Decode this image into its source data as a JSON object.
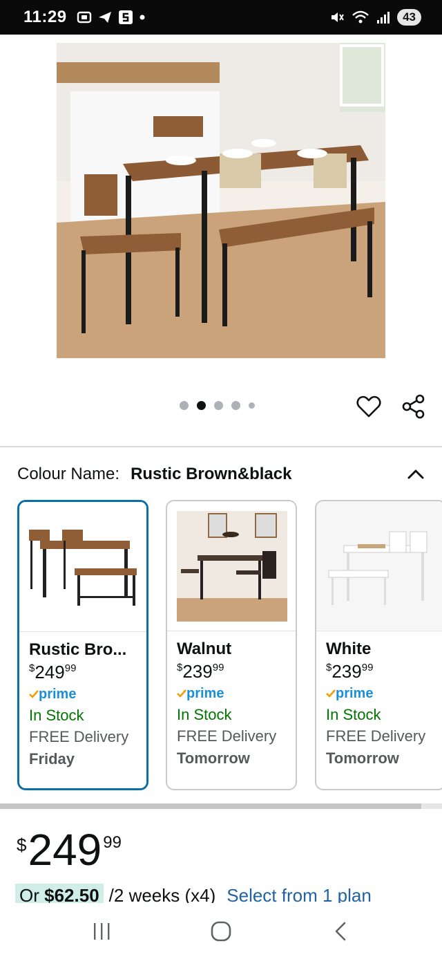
{
  "status_bar": {
    "time": "11:29",
    "battery": "43"
  },
  "carousel": {
    "dot_count": 5,
    "active_index": 1
  },
  "colour": {
    "label": "Colour Name:",
    "selected": "Rustic Brown&black"
  },
  "variants": [
    {
      "name": "Rustic Bro...",
      "price_symbol": "$",
      "price_whole": "249",
      "price_fraction": "99",
      "prime": "prime",
      "stock": "In Stock",
      "delivery": "FREE Delivery",
      "delivery_day": "Friday",
      "selected": true
    },
    {
      "name": "Walnut",
      "price_symbol": "$",
      "price_whole": "239",
      "price_fraction": "99",
      "prime": "prime",
      "stock": "In Stock",
      "delivery": "FREE Delivery",
      "delivery_day": "Tomorrow",
      "selected": false
    },
    {
      "name": "White",
      "price_symbol": "$",
      "price_whole": "239",
      "price_fraction": "99",
      "prime": "prime",
      "stock": "In Stock",
      "delivery": "FREE Delivery",
      "delivery_day": "Tomorrow",
      "selected": false
    }
  ],
  "price": {
    "symbol": "$",
    "whole": "249",
    "fraction": "99"
  },
  "plan": {
    "prefix": "Or",
    "amount": "$62.50",
    "period": "/2 weeks (x4)",
    "link": "Select from 1 plan"
  },
  "colors": {
    "accent_link": "#2162a1",
    "prime_blue": "#1a8fd8",
    "stock_green": "#007600",
    "selected_border": "#0a6fa8",
    "plan_highlight": "#cfeee7"
  },
  "icons": {
    "wishlist": "heart-icon",
    "share": "share-icon",
    "collapse": "chevron-up-icon"
  }
}
